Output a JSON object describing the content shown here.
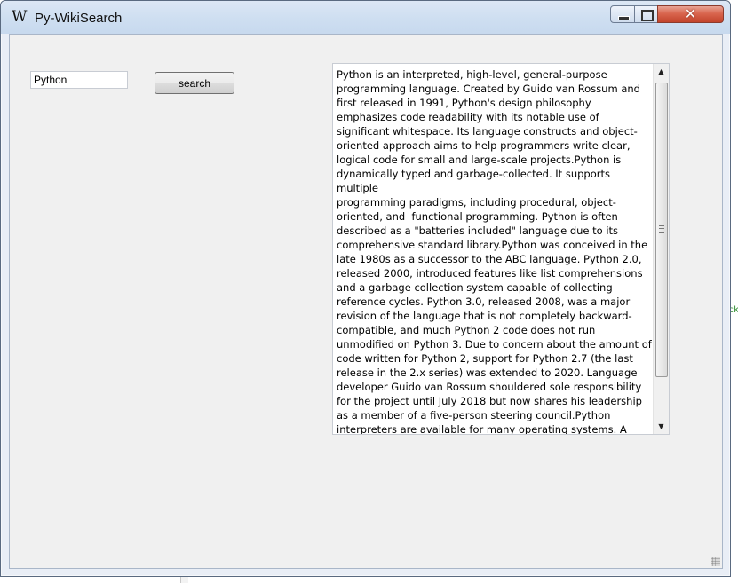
{
  "window": {
    "title": "Py-WikiSearch",
    "logo_glyph": "W",
    "close_glyph": "✕"
  },
  "search": {
    "query": "Python",
    "button_label": "search"
  },
  "result": {
    "text": "Python is an interpreted, high-level, general-purpose\nprogramming language. Created by Guido van Rossum and\nfirst released in 1991, Python's design philosophy\nemphasizes code readability with its notable use of\nsignificant whitespace. Its language constructs and object-\noriented approach aims to help programmers write clear,\nlogical code for small and large-scale projects.Python is\ndynamically typed and garbage-collected. It supports multiple\nprogramming paradigms, including procedural, object-\noriented, and  functional programming. Python is often\ndescribed as a \"batteries included\" language due to its\ncomprehensive standard library.Python was conceived in the\nlate 1980s as a successor to the ABC language. Python 2.0,\nreleased 2000, introduced features like list comprehensions\nand a garbage collection system capable of collecting\nreference cycles. Python 3.0, released 2008, was a major\nrevision of the language that is not completely backward-\ncompatible, and much Python 2 code does not run\nunmodified on Python 3. Due to concern about the amount of\ncode written for Python 2, support for Python 2.7 (the last\nrelease in the 2.x series) was extended to 2020. Language\ndeveloper Guido van Rossum shouldered sole responsibility\nfor the project until July 2018 but now shares his leadership\nas a member of a five-person steering council.Python\ninterpreters are available for many operating systems. A\nglobal community of programmers develops and maintains"
  },
  "background": {
    "bottom_fragment": "Ln",
    "right_fragment": "ck"
  }
}
